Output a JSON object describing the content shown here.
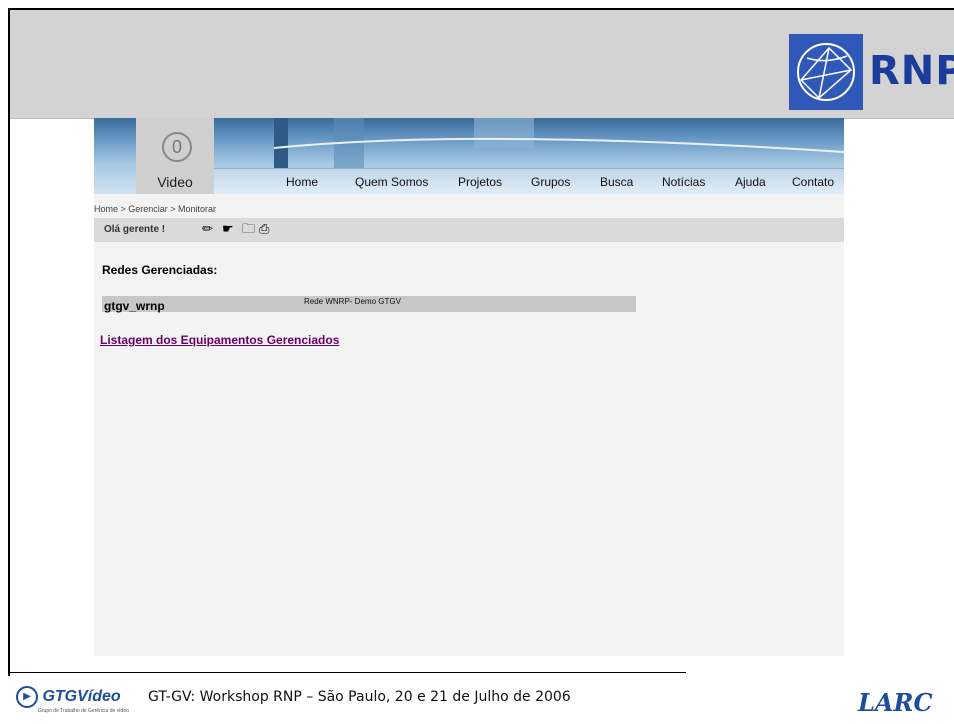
{
  "slide": {
    "rnp_logo_text": "RNP",
    "footer_caption": "GT-GV: Workshop RNP – São Paulo, 20 e 21 de Julho de 2006",
    "gtg_logo_text": "GTGVídeo",
    "gtg_logo_sub": "Grupo de Trabalho de Gerência de vídeo",
    "lar_logo_text": "LARC"
  },
  "site": {
    "logo_label": "Video",
    "nav": [
      "Home",
      "Quem Somos",
      "Projetos",
      "Grupos",
      "Busca",
      "Notícias",
      "Ajuda",
      "Contato"
    ],
    "breadcrumb": "Home  >  Gerenciar  >  Monitorar",
    "greeting": "Olá gerente !",
    "toolbar_icons": [
      "edit-icon",
      "hand-icon",
      "folder-icon",
      "print-icon"
    ]
  },
  "main": {
    "heading": "Redes Gerenciadas:",
    "networks": [
      {
        "name": "gtgv_wrnp",
        "description": "Rede WNRP- Demo GTGV"
      }
    ],
    "equipment_link": "Listagem dos Equipamentos Gerenciados"
  },
  "colors": {
    "band": "#d3d3d3",
    "brand_blue": "#1d4d9c",
    "link_visited": "#660066"
  }
}
